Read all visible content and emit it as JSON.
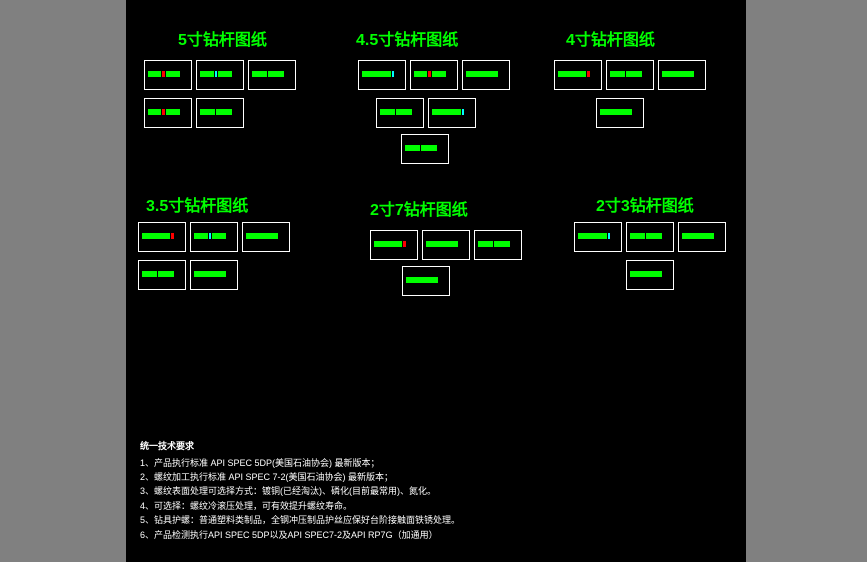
{
  "sections": {
    "s5": {
      "title": "5寸钻杆图纸"
    },
    "s45": {
      "title": "4.5寸钻杆图纸"
    },
    "s4": {
      "title": "4寸钻杆图纸"
    },
    "s35": {
      "title": "3.5寸钻杆图纸"
    },
    "s27": {
      "title": "2寸7钻杆图纸"
    },
    "s23": {
      "title": "2寸3钻杆图纸"
    }
  },
  "notes": {
    "title": "统一技术要求",
    "line1": "1、产品执行标准 API SPEC 5DP(美国石油协会) 最新版本；",
    "line2": "2、螺纹加工执行标准 API SPEC 7-2(美国石油协会) 最新版本；",
    "line3": "3、螺纹表面处理可选择方式：镀铜(已经淘汰)、磷化(目前最常用)、氮化。",
    "line4": "4、可选择：螺纹冷滚压处理，可有效提升螺纹寿命。",
    "line5": "5、钻具护螺：普通塑料类制品，全钢冲压制品护丝应保好台阶接触面铁锈处理。",
    "line6": "6、产品检测执行API SPEC 5DP以及API SPEC7-2及API RP7G（加通用）"
  }
}
